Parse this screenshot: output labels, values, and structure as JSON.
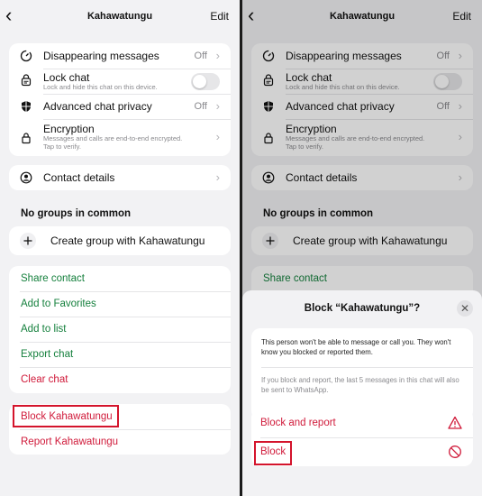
{
  "header": {
    "title": "Kahawatungu",
    "edit": "Edit"
  },
  "settings": [
    {
      "label": "Disappearing messages",
      "value": "Off"
    },
    {
      "label": "Lock chat",
      "sub": "Lock and hide this chat on this device."
    },
    {
      "label": "Advanced chat privacy",
      "value": "Off"
    },
    {
      "label": "Encryption",
      "sub1": "Messages and calls are end-to-end encrypted.",
      "sub2": "Tap to verify."
    }
  ],
  "contact": {
    "label": "Contact details"
  },
  "groups": {
    "title": "No groups in common",
    "create": "Create group with Kahawatungu"
  },
  "actions": [
    "Share contact",
    "Add to Favorites",
    "Add to list",
    "Export chat",
    "Clear chat"
  ],
  "block": {
    "block": "Block Kahawatungu",
    "report": "Report Kahawatungu"
  },
  "sheet": {
    "title": "Block “Kahawatungu”?",
    "info1": "This person won't be able to message or call you. They won't know you blocked or reported them.",
    "info2": "If you block and report, the last 5 messages in this chat will also be sent to WhatsApp.",
    "block_report": "Block and report",
    "block": "Block"
  },
  "colors": {
    "green": "#15803d",
    "red": "#d01a3a",
    "highlight": "#d4142c"
  }
}
